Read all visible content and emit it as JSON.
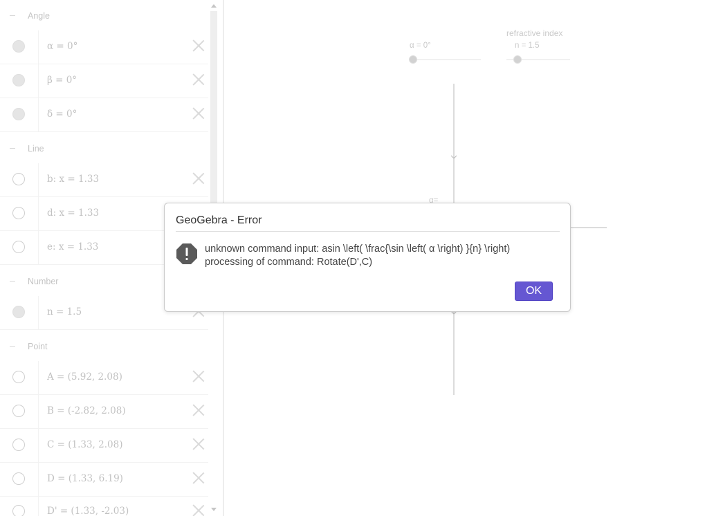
{
  "algebra": {
    "groups": {
      "angle": "Angle",
      "line": "Line",
      "number": "Number",
      "point": "Point"
    },
    "items": {
      "alpha": "α = 0°",
      "beta": "β = 0°",
      "delta": "δ = 0°",
      "b": "b: x = 1.33",
      "d": "d: x = 1.33",
      "e": "e: x = 1.33",
      "n": "n = 1.5",
      "A": "A = (5.92, 2.08)",
      "B": "B = (-2.82, 2.08)",
      "C": "C = (1.33, 2.08)",
      "D": "D = (1.33, 6.19)",
      "Dprime": "D' = (1.33, -2.03)"
    }
  },
  "graphics": {
    "slider_alpha": {
      "label": "α = 0°",
      "value_fraction": 0
    },
    "slider_n": {
      "caption": "refractive index",
      "label": "n = 1.5",
      "value_fraction": 0.17
    },
    "alpha_label": "α="
  },
  "dialog": {
    "title": "GeoGebra - Error",
    "message_line1": "unknown command input: asin \\left( \\frac{\\sin \\left( α \\right) }{n} \\right)",
    "message_line2": "processing of command: Rotate(D',C)",
    "ok_label": "OK"
  },
  "colors": {
    "ok_button": "#6557d2",
    "alert_icon": "#5a5a5a"
  }
}
